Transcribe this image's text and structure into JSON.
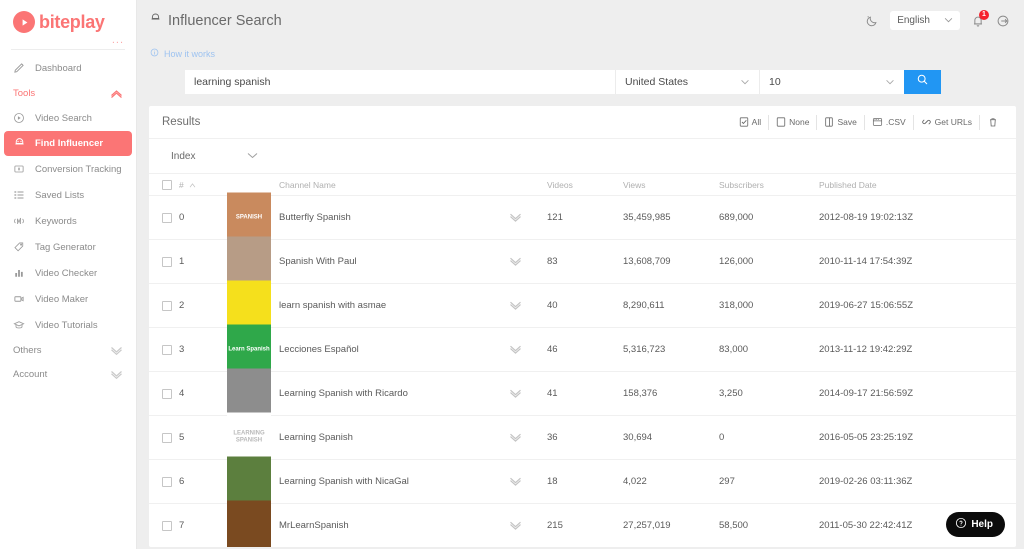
{
  "brand": {
    "name": "biteplay",
    "color": "#fb7575",
    "dots": "..."
  },
  "sidebar": {
    "items": [
      {
        "label": "Dashboard",
        "icon": "pencil-icon",
        "active": false
      },
      {
        "label": "Video Search",
        "icon": "play-circle-icon",
        "active": false
      },
      {
        "label": "Find Influencer",
        "icon": "influencer-icon",
        "active": true
      },
      {
        "label": "Conversion Tracking",
        "icon": "money-icon",
        "active": false
      },
      {
        "label": "Saved Lists",
        "icon": "list-icon",
        "active": false
      },
      {
        "label": "Keywords",
        "icon": "signal-icon",
        "active": false
      },
      {
        "label": "Tag Generator",
        "icon": "tag-icon",
        "active": false
      },
      {
        "label": "Video Checker",
        "icon": "bar-chart-icon",
        "active": false
      },
      {
        "label": "Video Maker",
        "icon": "video-camera-icon",
        "active": false
      },
      {
        "label": "Video Tutorials",
        "icon": "graduation-cap-icon",
        "active": false
      }
    ],
    "tools_label": "Tools",
    "others_label": "Others",
    "account_label": "Account"
  },
  "header": {
    "title": "Influencer Search",
    "language": "English",
    "notification_count": "1",
    "how_it_works": "How it works"
  },
  "search": {
    "query": "learning spanish",
    "query_placeholder": "learning spanish",
    "country": "United States",
    "count": "10"
  },
  "results": {
    "title": "Results",
    "toolbar": [
      {
        "label": "All",
        "icon": "checked-box-icon"
      },
      {
        "label": "None",
        "icon": "empty-box-icon"
      },
      {
        "label": "Save",
        "icon": "save-icon"
      },
      {
        "label": ".CSV",
        "icon": "csv-icon"
      },
      {
        "label": "Get URLs",
        "icon": "link-icon"
      }
    ],
    "trash_label": "",
    "index_label": "Index",
    "columns": {
      "num": "#",
      "channel": "Channel Name",
      "videos": "Videos",
      "views": "Views",
      "subscribers": "Subscribers",
      "published": "Published Date"
    },
    "rows": [
      {
        "index": "0",
        "channel": "Butterfly Spanish",
        "videos": "121",
        "views": "35,459,985",
        "subscribers": "689,000",
        "published": "2012-08-19 19:02:13Z",
        "thumb_bg": "#c98a5e",
        "thumb_text": "SPANISH"
      },
      {
        "index": "1",
        "channel": "Spanish With Paul",
        "videos": "83",
        "views": "13,608,709",
        "subscribers": "126,000",
        "published": "2010-11-14 17:54:39Z",
        "thumb_bg": "#b79c86",
        "thumb_text": ""
      },
      {
        "index": "2",
        "channel": "learn spanish with asmae",
        "videos": "40",
        "views": "8,290,611",
        "subscribers": "318,000",
        "published": "2019-06-27 15:06:55Z",
        "thumb_bg": "#f5e01c",
        "thumb_text": ""
      },
      {
        "index": "3",
        "channel": "Lecciones Español",
        "videos": "46",
        "views": "5,316,723",
        "subscribers": "83,000",
        "published": "2013-11-12 19:42:29Z",
        "thumb_bg": "#2fa84a",
        "thumb_text": "Learn Spanish"
      },
      {
        "index": "4",
        "channel": "Learning Spanish with Ricardo",
        "videos": "41",
        "views": "158,376",
        "subscribers": "3,250",
        "published": "2014-09-17 21:56:59Z",
        "thumb_bg": "#8d8d8d",
        "thumb_text": ""
      },
      {
        "index": "5",
        "channel": "Learning Spanish",
        "videos": "36",
        "views": "30,694",
        "subscribers": "0",
        "published": "2016-05-05 23:25:19Z",
        "thumb_bg": "#ffffff",
        "thumb_text": "LEARNING SPANISH"
      },
      {
        "index": "6",
        "channel": "Learning Spanish with NicaGal",
        "videos": "18",
        "views": "4,022",
        "subscribers": "297",
        "published": "2019-02-26 03:11:36Z",
        "thumb_bg": "#5c7f3e",
        "thumb_text": ""
      },
      {
        "index": "7",
        "channel": "MrLearnSpanish",
        "videos": "215",
        "views": "27,257,019",
        "subscribers": "58,500",
        "published": "2011-05-30 22:42:41Z",
        "thumb_bg": "#7a4a20",
        "thumb_text": ""
      }
    ]
  },
  "help": {
    "label": "Help"
  }
}
